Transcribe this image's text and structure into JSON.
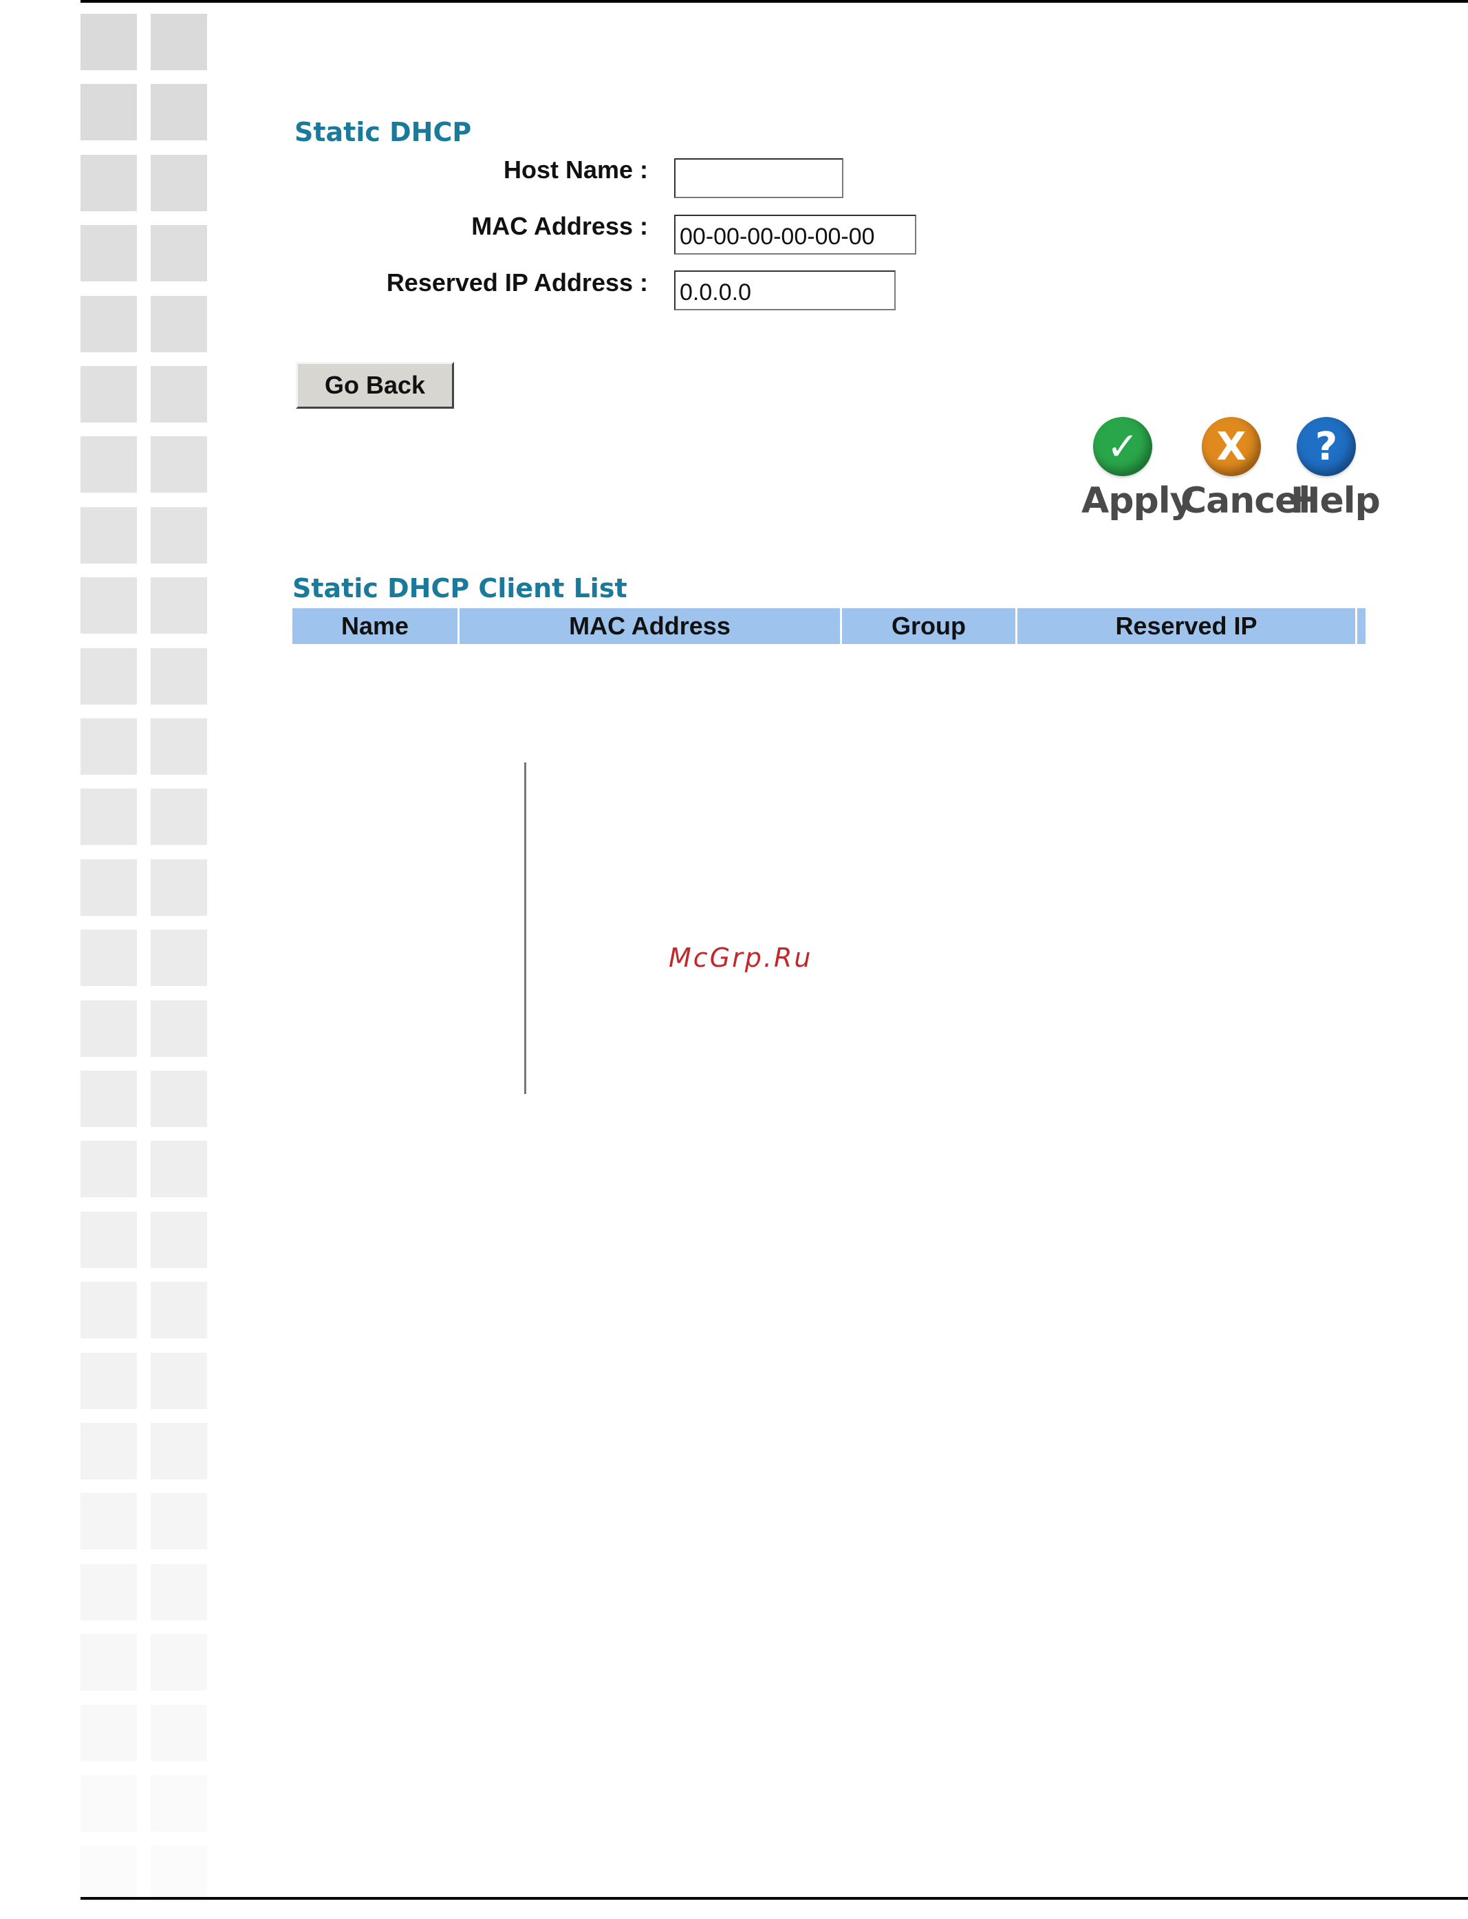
{
  "static_dhcp": {
    "title": "Static DHCP",
    "fields": [
      {
        "label": "Host Name :",
        "value": ""
      },
      {
        "label": "MAC Address :",
        "value": "00-00-00-00-00-00"
      },
      {
        "label": "Reserved IP Address :",
        "value": "0.0.0.0"
      }
    ],
    "go_back_label": "Go Back"
  },
  "actions": {
    "apply": {
      "label": "Apply",
      "glyph": "✓",
      "icon": "check-icon",
      "color": "#2aa64a"
    },
    "cancel": {
      "label": "Cancel",
      "glyph": "X",
      "icon": "cancel-x-icon",
      "color": "#e08a1e"
    },
    "help": {
      "label": "Help",
      "glyph": "?",
      "icon": "question-icon",
      "color": "#1f6fc4"
    }
  },
  "client_list": {
    "title": "Static DHCP Client List",
    "columns": [
      "Name",
      "MAC Address",
      "Group",
      "Reserved IP"
    ],
    "rows": []
  },
  "watermark": "McGrp.Ru",
  "colors": {
    "section_title": "#1a7a9c",
    "list_header": "#9ec3ec",
    "tile": "#dcdcdc"
  }
}
